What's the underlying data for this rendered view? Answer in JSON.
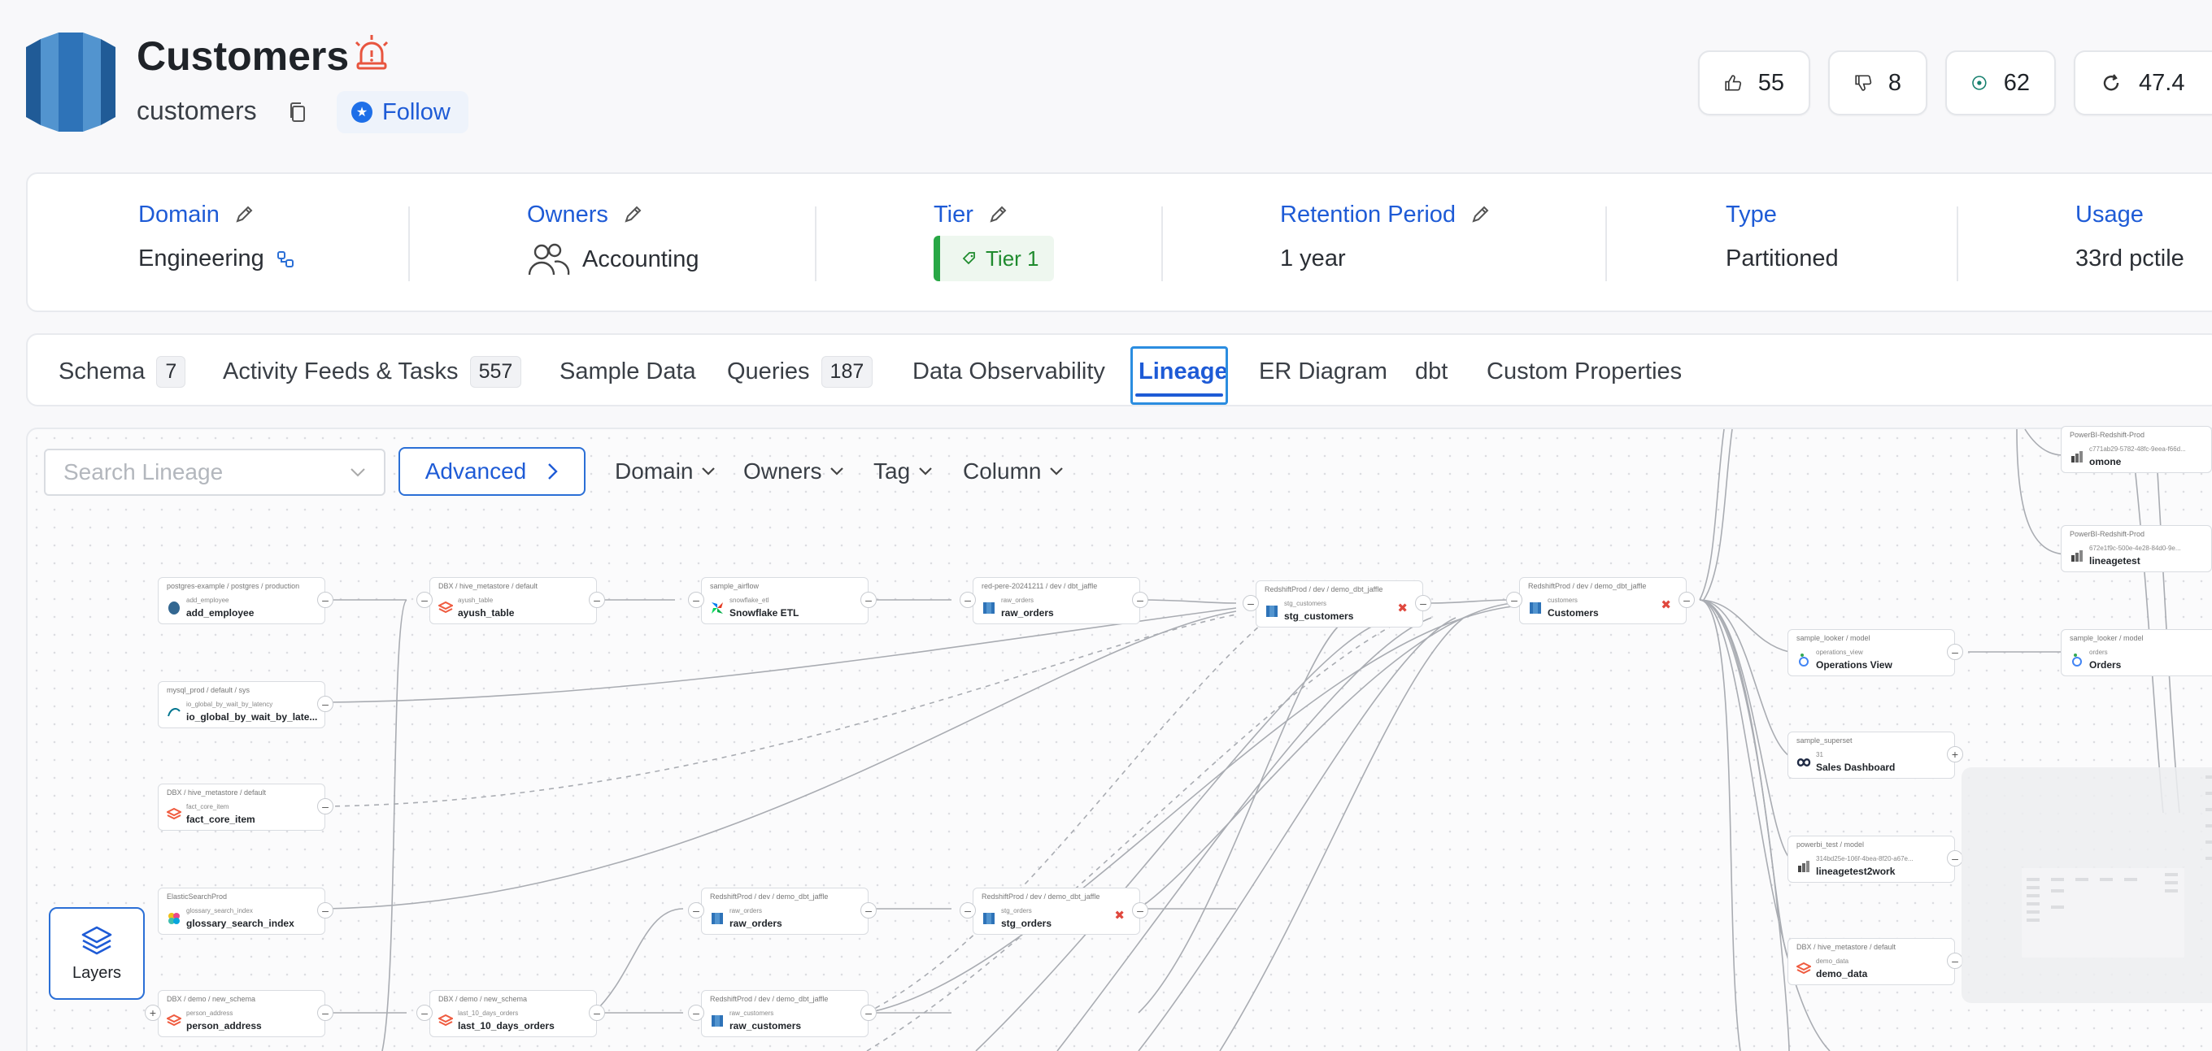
{
  "header": {
    "title": "Customers",
    "subname": "customers",
    "follow_label": "Follow",
    "stats": [
      {
        "icon": "thumbs-up-icon",
        "value": "55"
      },
      {
        "icon": "thumbs-down-icon",
        "value": "8"
      },
      {
        "icon": "target-icon",
        "value": "62"
      },
      {
        "icon": "refresh-icon",
        "value": "47.4"
      }
    ]
  },
  "info": {
    "domain": {
      "label": "Domain",
      "value": "Engineering"
    },
    "owners": {
      "label": "Owners",
      "value": "Accounting"
    },
    "tier": {
      "label": "Tier",
      "value": "Tier 1"
    },
    "retention": {
      "label": "Retention Period",
      "value": "1 year"
    },
    "type": {
      "label": "Type",
      "value": "Partitioned"
    },
    "usage": {
      "label": "Usage",
      "value": "33rd pctile"
    }
  },
  "tabs": [
    {
      "label": "Schema",
      "count": "7"
    },
    {
      "label": "Activity Feeds & Tasks",
      "count": "557"
    },
    {
      "label": "Sample Data",
      "count": ""
    },
    {
      "label": "Queries",
      "count": "187"
    },
    {
      "label": "Data Observability",
      "count": ""
    },
    {
      "label": "Lineage",
      "count": ""
    },
    {
      "label": "ER Diagram",
      "count": ""
    },
    {
      "label": "dbt",
      "count": ""
    },
    {
      "label": "Custom Properties",
      "count": ""
    }
  ],
  "lineage": {
    "search_placeholder": "Search Lineage",
    "advanced_label": "Advanced",
    "filters": [
      "Domain",
      "Owners",
      "Tag",
      "Column"
    ],
    "layers_label": "Layers",
    "nodes": [
      {
        "path": "postgres-example / postgres / production",
        "sub": "add_employee",
        "name": "add_employee"
      },
      {
        "path": "DBX / hive_metastore / default",
        "sub": "ayush_table",
        "name": "ayush_table"
      },
      {
        "path": "sample_airflow",
        "sub": "snowflake_etl",
        "name": "Snowflake ETL"
      },
      {
        "path": "red-pere-20241211 / dev / dbt_jaffle",
        "sub": "raw_orders",
        "name": "raw_orders"
      },
      {
        "path": "RedshiftProd / dev / demo_dbt_jaffle",
        "sub": "stg_customers",
        "name": "stg_customers"
      },
      {
        "path": "RedshiftProd / dev / demo_dbt_jaffle",
        "sub": "customers",
        "name": "Customers"
      },
      {
        "path": "mysql_prod / default / sys",
        "sub": "io_global_by_wait_by_latency",
        "name": "io_global_by_wait_by_late..."
      },
      {
        "path": "DBX / hive_metastore / default",
        "sub": "fact_core_item",
        "name": "fact_core_item"
      },
      {
        "path": "ElasticSearchProd",
        "sub": "glossary_search_index",
        "name": "glossary_search_index"
      },
      {
        "path": "DBX / demo / new_schema",
        "sub": "person_address",
        "name": "person_address"
      },
      {
        "path": "DBX / demo / new_schema",
        "sub": "last_10_days_orders",
        "name": "last_10_days_orders"
      },
      {
        "path": "RedshiftProd / dev / demo_dbt_jaffle",
        "sub": "raw_orders",
        "name": "raw_orders"
      },
      {
        "path": "RedshiftProd / dev / demo_dbt_jaffle",
        "sub": "raw_customers",
        "name": "raw_customers"
      },
      {
        "path": "RedshiftProd / dev / demo_dbt_jaffle",
        "sub": "stg_orders",
        "name": "stg_orders"
      },
      {
        "path": "sample_looker / model",
        "sub": "operations_view",
        "name": "Operations View"
      },
      {
        "path": "sample_looker / model",
        "sub": "orders",
        "name": "Orders"
      },
      {
        "path": "sample_superset",
        "sub": "31",
        "name": "Sales Dashboard"
      },
      {
        "path": "powerbi_test / model",
        "sub": "314bd25e-106f-4bea-8f20-a67e...",
        "name": "lineagetest2work"
      },
      {
        "path": "DBX / hive_metastore / default",
        "sub": "demo_data",
        "name": "demo_data"
      },
      {
        "path": "PowerBI-Redshift-Prod",
        "sub": "c771ab29-5782-48fc-9eea-f66d...",
        "name": "omone"
      },
      {
        "path": "PowerBI-Redshift-Prod",
        "sub": "672e1f9c-500e-4e28-84d0-9e...",
        "name": "lineagetest"
      }
    ]
  },
  "colors": {
    "accent": "#1e5bd6",
    "tier": "#28a745",
    "alert": "#e8553f"
  }
}
